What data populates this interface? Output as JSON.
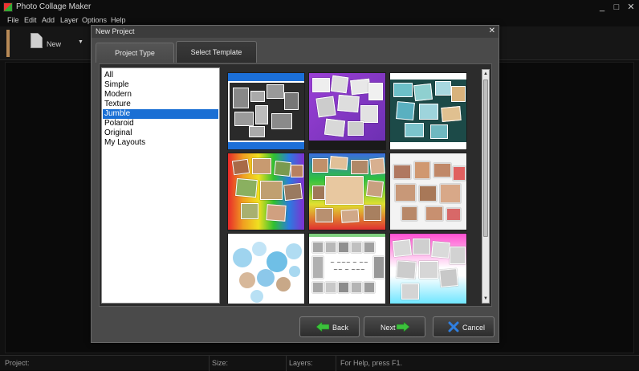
{
  "app": {
    "title": "Photo Collage Maker"
  },
  "window_controls": {
    "minimize": "_",
    "maximize": "□",
    "close": "✕"
  },
  "menu": [
    "File",
    "Edit",
    "Add",
    "Layer",
    "Options",
    "Help"
  ],
  "toolbar": {
    "new_label": "New",
    "new_caret": "▼",
    "new_icon": "document-icon"
  },
  "dialog": {
    "title": "New Project",
    "close": "✕",
    "tabs": [
      {
        "label": "Project Type",
        "active": false
      },
      {
        "label": "Select Template",
        "active": true
      }
    ],
    "categories": [
      {
        "label": "All",
        "selected": false
      },
      {
        "label": "Simple",
        "selected": false
      },
      {
        "label": "Modern",
        "selected": false
      },
      {
        "label": "Texture",
        "selected": false
      },
      {
        "label": "Jumble",
        "selected": true
      },
      {
        "label": "Polaroid",
        "selected": false
      },
      {
        "label": "Original",
        "selected": false
      },
      {
        "label": "My Layouts",
        "selected": false
      }
    ],
    "templates": [
      {
        "style": "blue-bar-dark-collage",
        "selected": true
      },
      {
        "style": "purple-polaroid-scatter",
        "selected": false
      },
      {
        "style": "teal-beach-collage",
        "selected": false
      },
      {
        "style": "rainbow-kids-collage",
        "selected": false
      },
      {
        "style": "rainbow-portrait-collage",
        "selected": false
      },
      {
        "style": "white-grunge-collage",
        "selected": false
      },
      {
        "style": "blue-bubble-collage",
        "selected": false
      },
      {
        "style": "love-quote-grid",
        "selected": false
      },
      {
        "style": "pink-gradient-blank-frames",
        "selected": false
      }
    ],
    "scroll": {
      "up": "▲",
      "down": "▼"
    },
    "buttons": {
      "back": "Back",
      "next": "Next",
      "cancel": "Cancel"
    },
    "colors": {
      "selected_category": "#1a6fd4",
      "back_arrow": "#3cc13c",
      "next_arrow": "#3cc13c",
      "cancel_icon": "#2f7fe0"
    }
  },
  "statusbar": {
    "project": "Project:",
    "size": "Size:",
    "layers": "Layers:",
    "help": "For Help, press F1."
  }
}
